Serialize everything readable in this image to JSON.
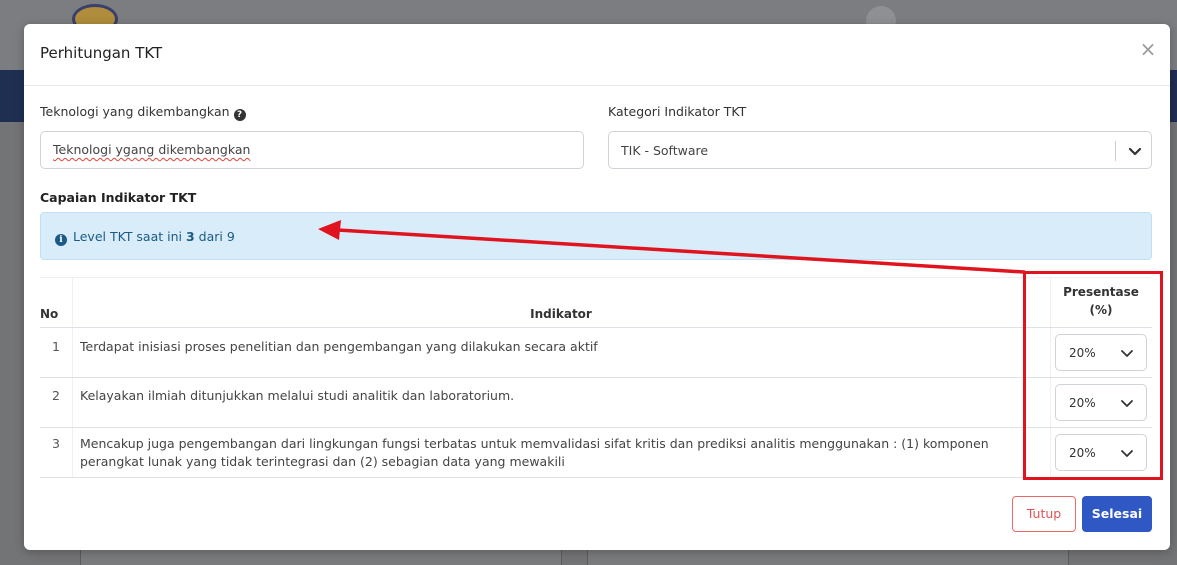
{
  "modal": {
    "title": "Perhitungan TKT",
    "close_glyph": "×"
  },
  "form": {
    "technology_label": "Teknologi yang dikembangkan",
    "technology_value": "Teknologi ygang dikembangkan",
    "category_label": "Kategori Indikator TKT",
    "category_value": "TIK - Software"
  },
  "achievement": {
    "section_title": "Capaian Indikator TKT",
    "level_prefix": "Level TKT saat ini",
    "level_current": "3",
    "level_mid": "dari",
    "level_max": "9"
  },
  "table": {
    "headers": {
      "no": "No",
      "indicator": "Indikator",
      "percentage_line1": "Presentase",
      "percentage_line2": "(%)"
    },
    "rows": [
      {
        "no": "1",
        "indicator": "Terdapat inisiasi proses penelitian dan pengembangan yang dilakukan secara aktif",
        "percentage": "20%"
      },
      {
        "no": "2",
        "indicator": "Kelayakan ilmiah ditunjukkan melalui studi analitik dan laboratorium.",
        "percentage": "20%"
      },
      {
        "no": "3",
        "indicator": "Mencakup juga pengembangan dari lingkungan fungsi terbatas untuk memvalidasi sifat kritis dan prediksi analitis menggunakan : (1) komponen",
        "indicator_line2": "perangkat lunak yang tidak terintegrasi dan (2) sebagian data yang mewakili",
        "percentage": "20%"
      }
    ]
  },
  "buttons": {
    "close": "Tutup",
    "done": "Selesai"
  },
  "colors": {
    "annotation": "#e0141e",
    "primary": "#2f58c5",
    "danger": "#e05555",
    "alert_bg": "#d9ecf9"
  },
  "icons": {
    "help": "question-circle-icon",
    "info": "info-circle-icon",
    "close": "close-icon",
    "dropdown": "chevron-down-icon"
  }
}
